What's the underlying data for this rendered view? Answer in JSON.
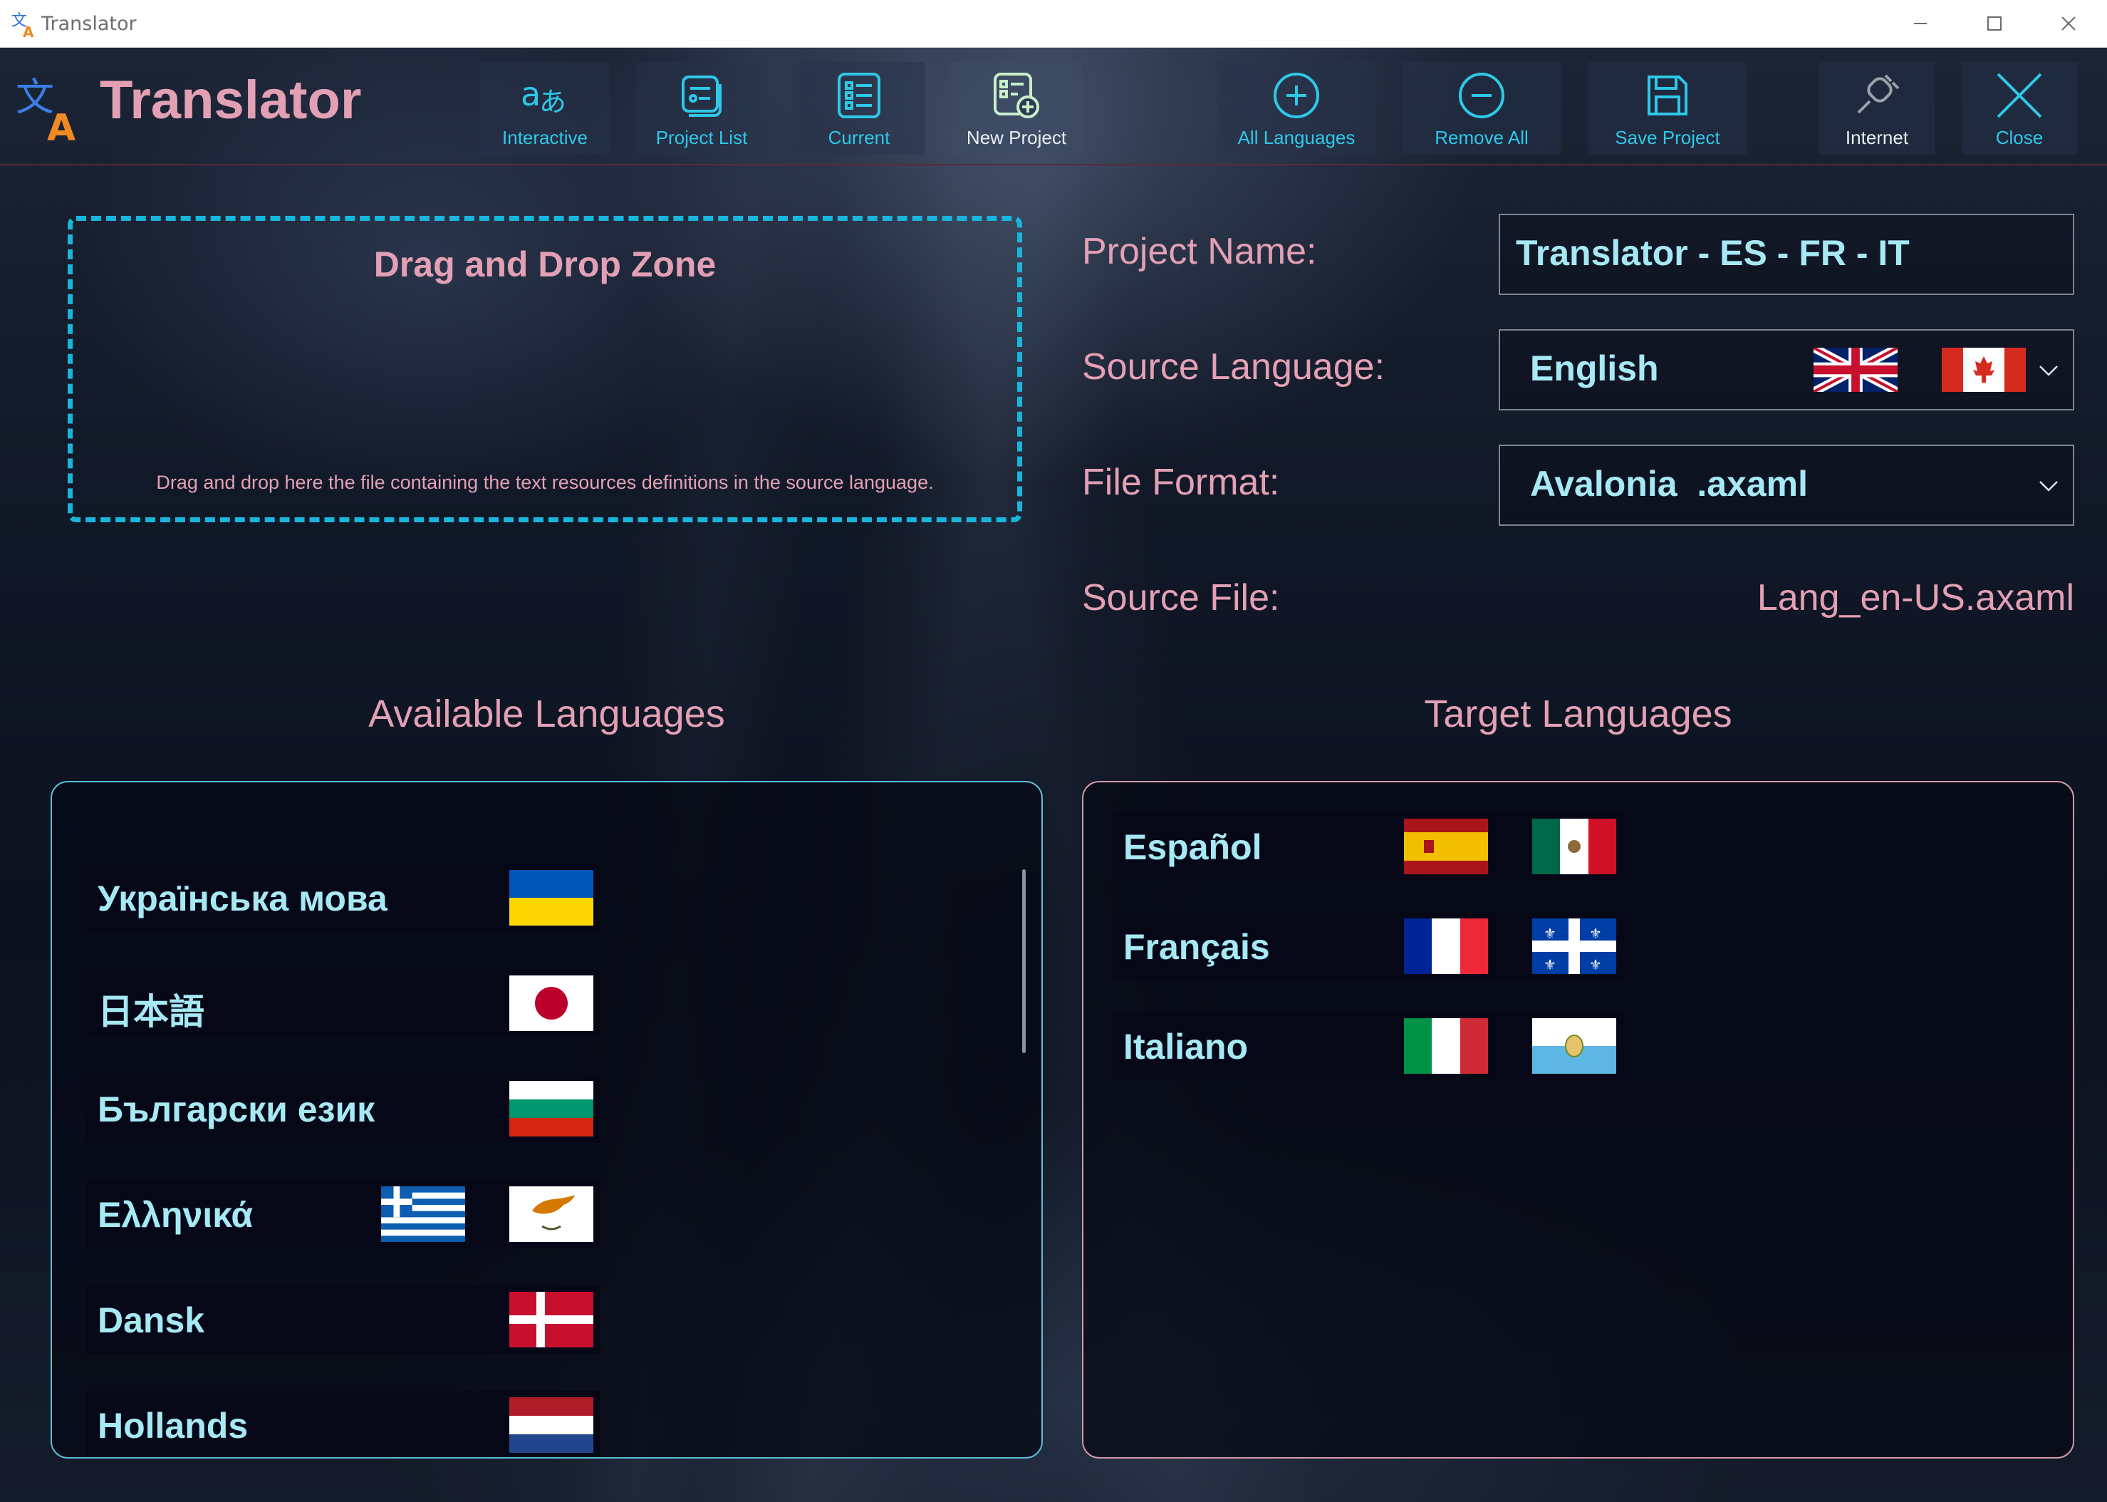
{
  "window": {
    "title": "Translator",
    "controls": [
      "minimize-icon",
      "maximize-icon",
      "close-icon"
    ]
  },
  "app": {
    "title": "Translator",
    "colors": {
      "accent": "#19b5dc",
      "pink": "#e3a0b4",
      "value": "#a6e9f5"
    }
  },
  "toolbar": {
    "interactive": "Interactive",
    "project_list": "Project List",
    "current": "Current",
    "new_project": "New Project",
    "all_languages": "All Languages",
    "remove_all": "Remove All",
    "save_project": "Save Project",
    "internet": "Internet",
    "close": "Close"
  },
  "dropzone": {
    "title": "Drag and Drop Zone",
    "description": "Drag and drop here the file containing the text resources definitions in the source language."
  },
  "form": {
    "project_name_label": "Project Name:",
    "project_name_value": "Translator - ES - FR - IT",
    "source_language_label": "Source Language:",
    "source_language_value": "English",
    "source_language_flags": [
      "uk-flag",
      "canada-flag"
    ],
    "file_format_label": "File Format:",
    "file_format_value": "Avalonia  .axaml",
    "source_file_label": "Source File:",
    "source_file_value": "Lang_en-US.axaml"
  },
  "available": {
    "title": "Available Languages",
    "items": [
      {
        "name": "Українська мова",
        "flags": [
          "ukraine-flag"
        ]
      },
      {
        "name": "日本語",
        "flags": [
          "japan-flag"
        ]
      },
      {
        "name": "Български език",
        "flags": [
          "bulgaria-flag"
        ]
      },
      {
        "name": "Ελληνικά",
        "flags": [
          "greece-flag",
          "cyprus-flag"
        ]
      },
      {
        "name": "Dansk",
        "flags": [
          "denmark-flag"
        ]
      },
      {
        "name": "Hollands",
        "flags": [
          "netherlands-flag"
        ]
      }
    ]
  },
  "target": {
    "title": "Target Languages",
    "items": [
      {
        "name": "Español",
        "flags": [
          "spain-flag",
          "mexico-flag"
        ]
      },
      {
        "name": "Français",
        "flags": [
          "france-flag",
          "quebec-flag"
        ]
      },
      {
        "name": "Italiano",
        "flags": [
          "italy-flag",
          "san-marino-flag"
        ]
      }
    ]
  }
}
